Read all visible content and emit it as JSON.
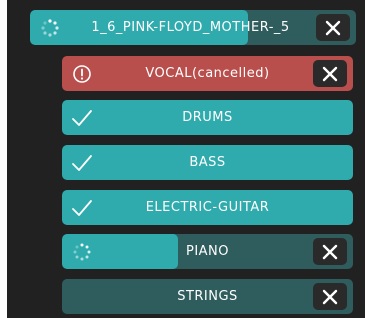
{
  "colors": {
    "panel_bg": "#212121",
    "teal_fill": "#2fabad",
    "teal_track": "#2f5c5d",
    "cancelled_red": "#b84f4d",
    "close_bg": "#2a2a2a",
    "text": "#ffffff"
  },
  "main": {
    "label": "1_6_PINK-FLOYD_MOTHER-_5",
    "progress": 0.67,
    "status_icon": "spinner-icon"
  },
  "stems": [
    {
      "label": "VOCAL(cancelled)",
      "status": "cancelled",
      "status_icon": "alert-circle-icon",
      "progress": 1.0
    },
    {
      "label": "DRUMS",
      "status": "done",
      "status_icon": "checkmark-icon",
      "progress": 1.0
    },
    {
      "label": "BASS",
      "status": "done",
      "status_icon": "checkmark-icon",
      "progress": 1.0
    },
    {
      "label": "ELECTRIC-GUITAR",
      "status": "done",
      "status_icon": "checkmark-icon",
      "progress": 1.0
    },
    {
      "label": "PIANO",
      "status": "processing",
      "status_icon": "spinner-icon",
      "progress": 0.4
    },
    {
      "label": "STRINGS",
      "status": "queued",
      "status_icon": "",
      "progress": 0.0
    }
  ]
}
